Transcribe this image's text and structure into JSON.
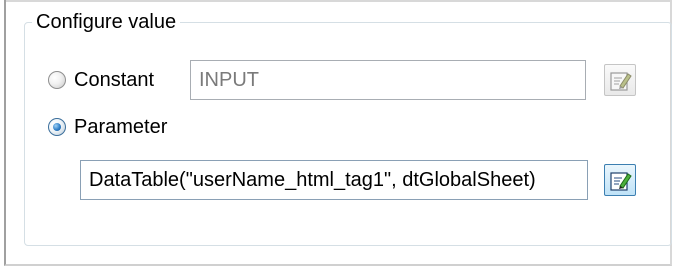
{
  "group": {
    "title": "Configure value"
  },
  "options": {
    "constant": {
      "label": "Constant",
      "checked": false,
      "value": "INPUT"
    },
    "parameter": {
      "label": "Parameter",
      "checked": true,
      "value": "DataTable(\"userName_html_tag1\", dtGlobalSheet)"
    }
  },
  "icons": {
    "constant_edit": "edit-pencil-icon",
    "parameter_edit": "edit-pencil-icon"
  }
}
